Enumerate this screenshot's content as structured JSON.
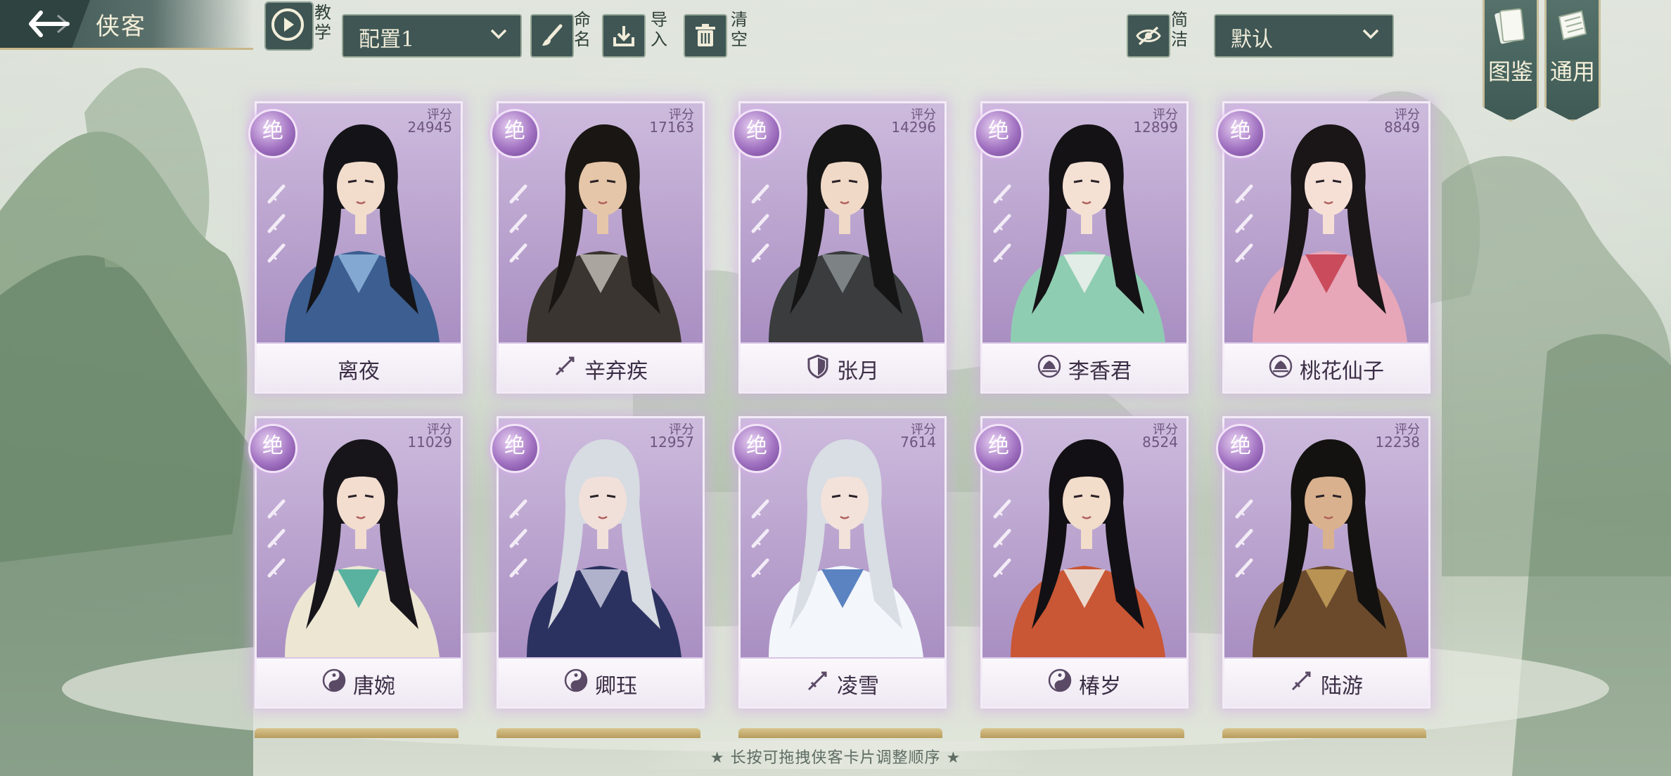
{
  "header": {
    "title": "侠客",
    "tutorial_label": "教学",
    "preset_value": "配置1",
    "rename_label": "命名",
    "import_label": "导入",
    "clear_label": "清空",
    "simple_label": "简洁",
    "sort_value": "默认"
  },
  "side_tabs": [
    {
      "label": "图鉴"
    },
    {
      "label": "通用"
    }
  ],
  "cards": [
    {
      "name": "离夜",
      "rank": "绝",
      "score_label": "评分",
      "score": "24945",
      "role_icon": "none",
      "palette": "blue-dark"
    },
    {
      "name": "辛弃疾",
      "rank": "绝",
      "score_label": "评分",
      "score": "17163",
      "role_icon": "sword-icon",
      "palette": "dark-armor"
    },
    {
      "name": "张月",
      "rank": "绝",
      "score_label": "评分",
      "score": "14296",
      "role_icon": "shield-icon",
      "palette": "hat-gray"
    },
    {
      "name": "李香君",
      "rank": "绝",
      "score_label": "评分",
      "score": "12899",
      "role_icon": "lotus-icon",
      "palette": "mint-dress"
    },
    {
      "name": "桃花仙子",
      "rank": "绝",
      "score_label": "评分",
      "score": "8849",
      "role_icon": "lotus-icon",
      "palette": "pink-robe"
    },
    {
      "name": "唐婉",
      "rank": "绝",
      "score_label": "评分",
      "score": "11029",
      "role_icon": "yinyang-icon",
      "palette": "cream-teal"
    },
    {
      "name": "卿珏",
      "rank": "绝",
      "score_label": "评分",
      "score": "12957",
      "role_icon": "yinyang-icon",
      "palette": "silver-navy"
    },
    {
      "name": "凌雪",
      "rank": "绝",
      "score_label": "评分",
      "score": "7614",
      "role_icon": "sword-icon",
      "palette": "white-blue"
    },
    {
      "name": "椿岁",
      "rank": "绝",
      "score_label": "评分",
      "score": "8524",
      "role_icon": "yinyang-icon",
      "palette": "red-white"
    },
    {
      "name": "陆游",
      "rank": "绝",
      "score_label": "评分",
      "score": "12238",
      "role_icon": "sword-icon",
      "palette": "brown-gold"
    }
  ],
  "footer": {
    "hint": "★ 长按可拖拽侠客卡片调整顺序 ★"
  },
  "colors": {
    "card_bg": "#b49cc9",
    "header_bg": "#3f5654",
    "accent_gold": "#c9b78a"
  }
}
